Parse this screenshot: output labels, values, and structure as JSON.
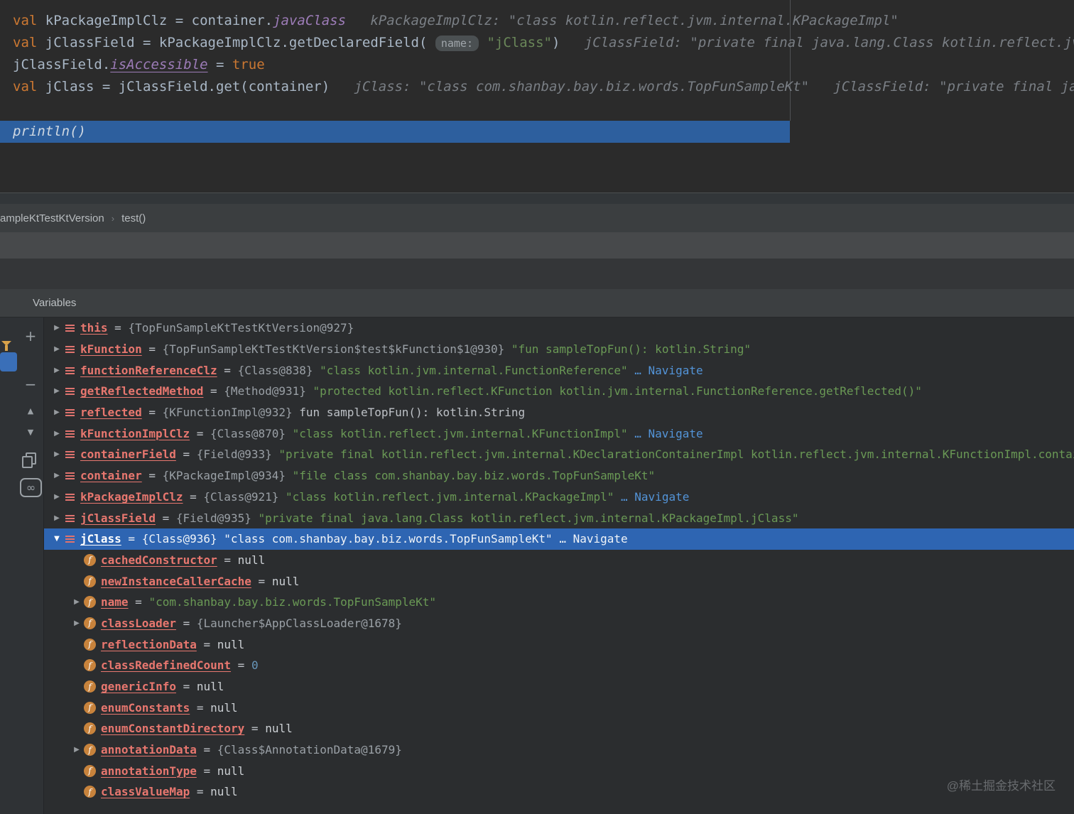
{
  "editor": {
    "lines": [
      {
        "segments": [
          [
            "kw",
            "val"
          ],
          [
            "plain",
            " kPackageImplClz = container."
          ],
          [
            "prop",
            "javaClass"
          ],
          [
            "hint",
            "   kPackageImplClz: \"class kotlin.reflect.jvm.internal.KPackageImpl\""
          ]
        ]
      },
      {
        "segments": [
          [
            "kw",
            "val"
          ],
          [
            "plain",
            " jClassField = kPackageImplClz.getDeclaredField( "
          ],
          [
            "pill",
            "name:"
          ],
          [
            "str",
            " \"jClass\""
          ],
          [
            "plain",
            ")"
          ],
          [
            "hint",
            "   jClassField: \"private final java.lang.Class kotlin.reflect.jvm.internal.KPackageImpl.jClass\""
          ]
        ]
      },
      {
        "segments": [
          [
            "plain",
            "jClassField."
          ],
          [
            "propu",
            "isAccessible"
          ],
          [
            "plain",
            " = "
          ],
          [
            "kw",
            "true"
          ]
        ]
      },
      {
        "segments": [
          [
            "kw",
            "val"
          ],
          [
            "plain",
            " jClass = jClassField.get(container)"
          ],
          [
            "hint",
            "   jClass: \"class com.shanbay.bay.biz.words.TopFunSampleKt\""
          ],
          [
            "hint",
            "   jClassField: \"private final java.lang.Class kotlin.reflect.jvm.internal.KPackageImpl.jClass\""
          ]
        ]
      }
    ],
    "execution_line": "println()"
  },
  "breadcrumb": {
    "frame": "ampleKtTestKtVersion",
    "separator": "›",
    "method": "test()"
  },
  "variables_panel": {
    "title": "Variables",
    "toolbar": {
      "add": "+",
      "remove": "−",
      "up": "▲",
      "down": "▼",
      "watches": "∞"
    },
    "icons": {
      "collapsed": "▶",
      "expanded": "▼"
    },
    "rows": [
      {
        "level": 0,
        "arrow": "right",
        "icon": "var",
        "name": "this",
        "segments": [
          [
            "eq",
            " = "
          ],
          [
            "ref",
            "{TopFunSampleKtTestKtVersion@927}"
          ]
        ]
      },
      {
        "level": 0,
        "arrow": "right",
        "icon": "var",
        "name": "kFunction",
        "segments": [
          [
            "eq",
            " = "
          ],
          [
            "ref",
            "{TopFunSampleKtTestKtVersion$test$kFunction$1@930} "
          ],
          [
            "strv",
            "\"fun sampleTopFun(): kotlin.String\""
          ]
        ]
      },
      {
        "level": 0,
        "arrow": "right",
        "icon": "var",
        "name": "functionReferenceClz",
        "segments": [
          [
            "eq",
            " = "
          ],
          [
            "ref",
            "{Class@838} "
          ],
          [
            "strv",
            "\"class kotlin.jvm.internal.FunctionReference\" "
          ],
          [
            "link",
            "… Navigate"
          ]
        ]
      },
      {
        "level": 0,
        "arrow": "right",
        "icon": "var",
        "name": "getReflectedMethod",
        "segments": [
          [
            "eq",
            " = "
          ],
          [
            "ref",
            "{Method@931} "
          ],
          [
            "strv",
            "\"protected kotlin.reflect.KFunction kotlin.jvm.internal.FunctionReference.getReflected()\""
          ]
        ]
      },
      {
        "level": 0,
        "arrow": "right",
        "icon": "var",
        "name": "reflected",
        "segments": [
          [
            "eq",
            " = "
          ],
          [
            "ref",
            "{KFunctionImpl@932} "
          ],
          [
            "plainv",
            "fun sampleTopFun(): kotlin.String"
          ]
        ]
      },
      {
        "level": 0,
        "arrow": "right",
        "icon": "var",
        "name": "kFunctionImplClz",
        "segments": [
          [
            "eq",
            " = "
          ],
          [
            "ref",
            "{Class@870} "
          ],
          [
            "strv",
            "\"class kotlin.reflect.jvm.internal.KFunctionImpl\" "
          ],
          [
            "link",
            "… Navigate"
          ]
        ]
      },
      {
        "level": 0,
        "arrow": "right",
        "icon": "var",
        "name": "containerField",
        "segments": [
          [
            "eq",
            " = "
          ],
          [
            "ref",
            "{Field@933} "
          ],
          [
            "strv",
            "\"private final kotlin.reflect.jvm.internal.KDeclarationContainerImpl kotlin.reflect.jvm.internal.KFunctionImpl.container\""
          ]
        ]
      },
      {
        "level": 0,
        "arrow": "right",
        "icon": "var",
        "name": "container",
        "segments": [
          [
            "eq",
            " = "
          ],
          [
            "ref",
            "{KPackageImpl@934} "
          ],
          [
            "strv",
            "\"file class com.shanbay.bay.biz.words.TopFunSampleKt\""
          ]
        ]
      },
      {
        "level": 0,
        "arrow": "right",
        "icon": "var",
        "name": "kPackageImplClz",
        "segments": [
          [
            "eq",
            " = "
          ],
          [
            "ref",
            "{Class@921} "
          ],
          [
            "strv",
            "\"class kotlin.reflect.jvm.internal.KPackageImpl\" "
          ],
          [
            "link",
            "… Navigate"
          ]
        ]
      },
      {
        "level": 0,
        "arrow": "right",
        "icon": "var",
        "name": "jClassField",
        "segments": [
          [
            "eq",
            " = "
          ],
          [
            "ref",
            "{Field@935} "
          ],
          [
            "strv",
            "\"private final java.lang.Class kotlin.reflect.jvm.internal.KPackageImpl.jClass\""
          ]
        ]
      },
      {
        "level": 0,
        "arrow": "down",
        "icon": "var",
        "name": "jClass",
        "selected": true,
        "segments": [
          [
            "eq",
            " = "
          ],
          [
            "ref",
            "{Class@936} "
          ],
          [
            "strv",
            "\"class com.shanbay.bay.biz.words.TopFunSampleKt\" "
          ],
          [
            "link",
            "… Navigate"
          ]
        ]
      },
      {
        "level": 1,
        "arrow": "none",
        "icon": "field",
        "name": "cachedConstructor",
        "segments": [
          [
            "eq",
            " = "
          ],
          [
            "nul",
            "null"
          ]
        ]
      },
      {
        "level": 1,
        "arrow": "none",
        "icon": "field",
        "name": "newInstanceCallerCache",
        "segments": [
          [
            "eq",
            " = "
          ],
          [
            "nul",
            "null"
          ]
        ]
      },
      {
        "level": 1,
        "arrow": "right",
        "icon": "field",
        "name": "name",
        "segments": [
          [
            "eq",
            " = "
          ],
          [
            "strv",
            "\"com.shanbay.bay.biz.words.TopFunSampleKt\""
          ]
        ]
      },
      {
        "level": 1,
        "arrow": "right",
        "icon": "field",
        "name": "classLoader",
        "segments": [
          [
            "eq",
            " = "
          ],
          [
            "ref",
            "{Launcher$AppClassLoader@1678}"
          ]
        ]
      },
      {
        "level": 1,
        "arrow": "none",
        "icon": "field",
        "name": "reflectionData",
        "segments": [
          [
            "eq",
            " = "
          ],
          [
            "nul",
            "null"
          ]
        ]
      },
      {
        "level": 1,
        "arrow": "none",
        "icon": "field",
        "name": "classRedefinedCount",
        "segments": [
          [
            "eq",
            " = "
          ],
          [
            "num",
            "0"
          ]
        ]
      },
      {
        "level": 1,
        "arrow": "none",
        "icon": "field",
        "name": "genericInfo",
        "segments": [
          [
            "eq",
            " = "
          ],
          [
            "nul",
            "null"
          ]
        ]
      },
      {
        "level": 1,
        "arrow": "none",
        "icon": "field",
        "name": "enumConstants",
        "segments": [
          [
            "eq",
            " = "
          ],
          [
            "nul",
            "null"
          ]
        ]
      },
      {
        "level": 1,
        "arrow": "none",
        "icon": "field",
        "name": "enumConstantDirectory",
        "segments": [
          [
            "eq",
            " = "
          ],
          [
            "nul",
            "null"
          ]
        ]
      },
      {
        "level": 1,
        "arrow": "right",
        "icon": "field",
        "name": "annotationData",
        "segments": [
          [
            "eq",
            " = "
          ],
          [
            "ref",
            "{Class$AnnotationData@1679}"
          ]
        ]
      },
      {
        "level": 1,
        "arrow": "none",
        "icon": "field",
        "name": "annotationType",
        "segments": [
          [
            "eq",
            " = "
          ],
          [
            "nul",
            "null"
          ]
        ]
      },
      {
        "level": 1,
        "arrow": "none",
        "icon": "field",
        "name": "classValueMap",
        "segments": [
          [
            "eq",
            " = "
          ],
          [
            "nul",
            "null"
          ]
        ]
      }
    ]
  },
  "watermark": "@稀土掘金技术社区",
  "colors": {
    "editor_bg": "#2b2b2b",
    "selection_blue": "#2e65b2",
    "execution_line_blue": "#2d5f9e",
    "keyword_orange": "#cc7832",
    "string_green": "#6a8759",
    "variable_name_salmon": "#e8776f",
    "link_blue": "#5394d8",
    "field_icon_orange": "#c8833c"
  }
}
